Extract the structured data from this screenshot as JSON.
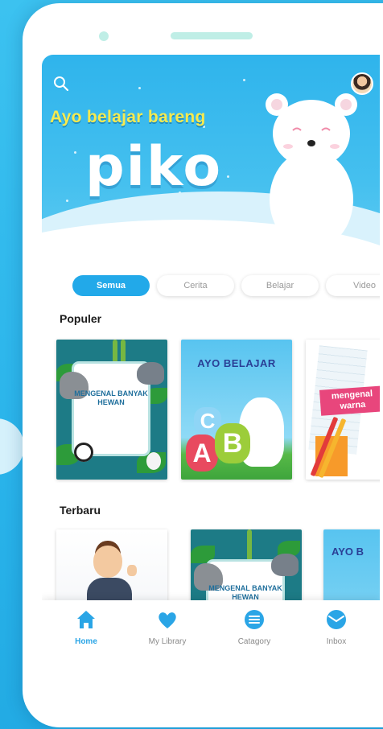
{
  "banner": {
    "tagline": "Ayo belajar bareng",
    "logo_text": "piko",
    "slides_total": 3,
    "slide_active": 2
  },
  "filters": {
    "chips": [
      "Semua",
      "Cerita",
      "Belajar",
      "Video"
    ],
    "active": "Semua"
  },
  "sections": {
    "populer": {
      "title": "Populer",
      "cards": [
        {
          "title": "MENGENAL BANYAK HEWAN"
        },
        {
          "title": "AYO BELAJAR",
          "letters": [
            "C",
            "A",
            "B"
          ]
        },
        {
          "title": "mengenal warna"
        }
      ]
    },
    "terbaru": {
      "title": "Terbaru",
      "cards": [
        {
          "title": ""
        },
        {
          "title": "MENGENAL BANYAK HEWAN"
        },
        {
          "title": "AYO B"
        }
      ]
    }
  },
  "bottom_nav": [
    {
      "label": "Home",
      "icon": "home-icon",
      "active": true
    },
    {
      "label": "My Library",
      "icon": "heart-icon",
      "active": false
    },
    {
      "label": "Catagory",
      "icon": "list-icon",
      "active": false
    },
    {
      "label": "Inbox",
      "icon": "inbox-icon",
      "active": false
    }
  ],
  "colors": {
    "accent": "#22a9e9",
    "background": "#2fb3ea",
    "tagline": "#f6ea4f",
    "card_label_pink": "#e8467c"
  }
}
